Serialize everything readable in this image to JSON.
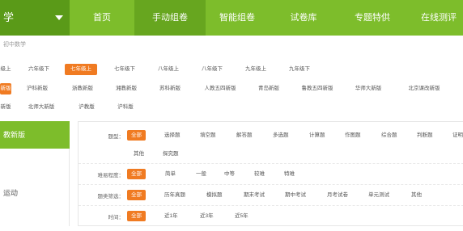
{
  "header": {
    "subject_label": "学",
    "nav": [
      "首页",
      "手动组卷",
      "智能组卷",
      "试卷库",
      "专题特供",
      "在线测评"
    ],
    "active_nav_index": 1
  },
  "breadcrumb": "初中数学",
  "grades": [
    "级上",
    "六年级下",
    "七年级上",
    "七年级下",
    "八年级上",
    "八年级下",
    "九年级上",
    "九年级下"
  ],
  "active_grade_index": 2,
  "editions_row1": [
    "新版",
    "沪科新版",
    "浙教新版",
    "湘教新版",
    "苏科新版",
    "人教五四新版",
    "青岛新版",
    "鲁教五四新版",
    "华师大新版",
    "北京课改新版"
  ],
  "editions_row2": [
    "新版",
    "北师大新版",
    "沪教版",
    "沪科版"
  ],
  "active_edition_index": 0,
  "sidebar": {
    "active_label": "教新版",
    "item_label": "运动"
  },
  "filters": {
    "type": {
      "label": "题型：",
      "options": [
        "全部",
        "选择题",
        "填空题",
        "解答题",
        "多选题",
        "计算题",
        "作图题",
        "综合题",
        "判断题",
        "证明题",
        "其他",
        "探究题"
      ]
    },
    "difficulty": {
      "label": "难易程度：",
      "options": [
        "全部",
        "简单",
        "一般",
        "中等",
        "较难",
        "特难"
      ]
    },
    "category": {
      "label": "题类筛选：",
      "options": [
        "全部",
        "历年真题",
        "模拟题",
        "期末考试",
        "期中考试",
        "月考试卷",
        "单元测试",
        "其他"
      ]
    },
    "time": {
      "label": "时间：",
      "options": [
        "全部",
        "近1年",
        "近3年",
        "近5年"
      ]
    }
  },
  "colors": {
    "green": "#7dbd2b",
    "dark_green": "#5a9a18",
    "orange": "#f07b22"
  }
}
